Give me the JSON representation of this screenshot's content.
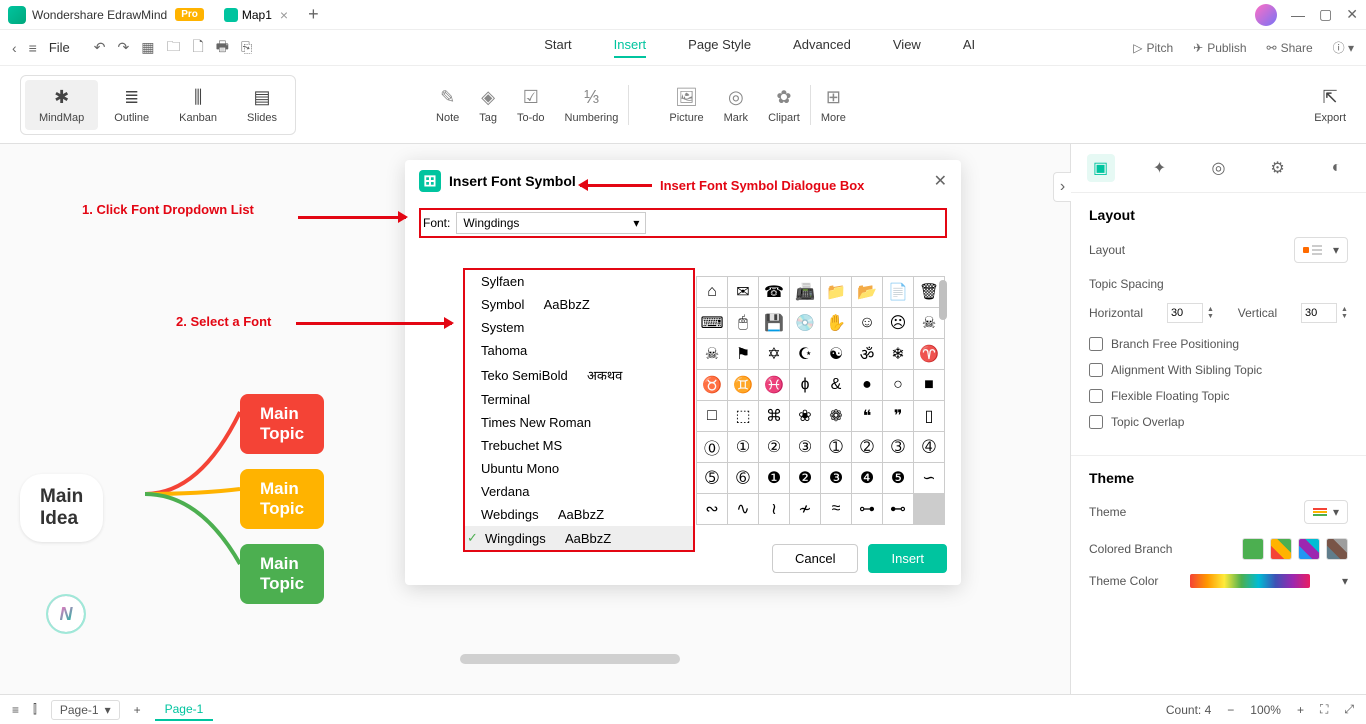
{
  "app": {
    "title": "Wondershare EdrawMind",
    "pro": "Pro",
    "tab": "Map1"
  },
  "menu": {
    "file": "File",
    "tabs": [
      "Start",
      "Insert",
      "Page Style",
      "Advanced",
      "View",
      "AI"
    ],
    "active": "Insert",
    "right": {
      "pitch": "Pitch",
      "publish": "Publish",
      "share": "Share"
    }
  },
  "toolbar": {
    "views": [
      "MindMap",
      "Outline",
      "Kanban",
      "Slides"
    ],
    "insert": [
      "Note",
      "Tag",
      "To-do",
      "Numbering"
    ],
    "media": [
      "Picture",
      "Mark",
      "Clipart",
      "More"
    ],
    "export": "Export"
  },
  "mindmap": {
    "main": "Main Idea",
    "topics": [
      "Main Topic",
      "Main Topic",
      "Main Topic"
    ]
  },
  "dialog": {
    "title": "Insert Font Symbol",
    "fontLabel": "Font:",
    "fontValue": "Wingdings",
    "fonts": [
      {
        "name": "Sylfaen"
      },
      {
        "name": "Symbol",
        "sample": "AaBbzZ"
      },
      {
        "name": "System"
      },
      {
        "name": "Tahoma"
      },
      {
        "name": "Teko SemiBold",
        "sample": "अकथव"
      },
      {
        "name": "Terminal"
      },
      {
        "name": "Times New Roman"
      },
      {
        "name": "Trebuchet MS"
      },
      {
        "name": "Ubuntu Mono"
      },
      {
        "name": "Verdana"
      },
      {
        "name": "Webdings",
        "sample": "AaBbzZ"
      },
      {
        "name": "Wingdings",
        "sample": "AaBbzZ",
        "selected": true
      }
    ],
    "symbols": [
      "⌂",
      "✉",
      "☎",
      "📠",
      "📁",
      "📂",
      "📄",
      "🗑",
      "⌨",
      "🖱",
      "💾",
      "💿",
      "✋",
      "☺",
      "☹",
      "☠",
      "☠",
      "⚑",
      "✡",
      "☪",
      "☯",
      "ॐ",
      "❄",
      "♈",
      "♉",
      "♊",
      "♓",
      "ɸ",
      "&",
      "●",
      "○",
      "■",
      "□",
      "⬚",
      "⌘",
      "❀",
      "❁",
      "❝",
      "❞",
      "▯",
      "⓪",
      "①",
      "②",
      "③",
      "➀",
      "➁",
      "➂",
      "➃",
      "➄",
      "➅",
      "❶",
      "❷",
      "❸",
      "❹",
      "❺",
      "∽",
      "∾",
      "∿",
      "≀",
      "≁",
      "≈",
      "⊶",
      "⊷"
    ],
    "cancel": "Cancel",
    "insert": "Insert"
  },
  "annotations": {
    "a1": "1. Click Font Dropdown List",
    "a2": "2. Select a Font",
    "a3": "Insert Font Symbol Dialogue Box"
  },
  "rightPanel": {
    "layout": "Layout",
    "layoutLbl": "Layout",
    "topicSpacing": "Topic Spacing",
    "horizontal": "Horizontal",
    "hVal": "30",
    "vertical": "Vertical",
    "vVal": "30",
    "checks": [
      "Branch Free Positioning",
      "Alignment With Sibling Topic",
      "Flexible Floating Topic",
      "Topic Overlap"
    ],
    "theme": "Theme",
    "themeLbl": "Theme",
    "coloredBranch": "Colored Branch",
    "themeColor": "Theme Color"
  },
  "status": {
    "page": "Page-1",
    "pageTab": "Page-1",
    "count": "Count: 4",
    "zoom": "100%"
  }
}
